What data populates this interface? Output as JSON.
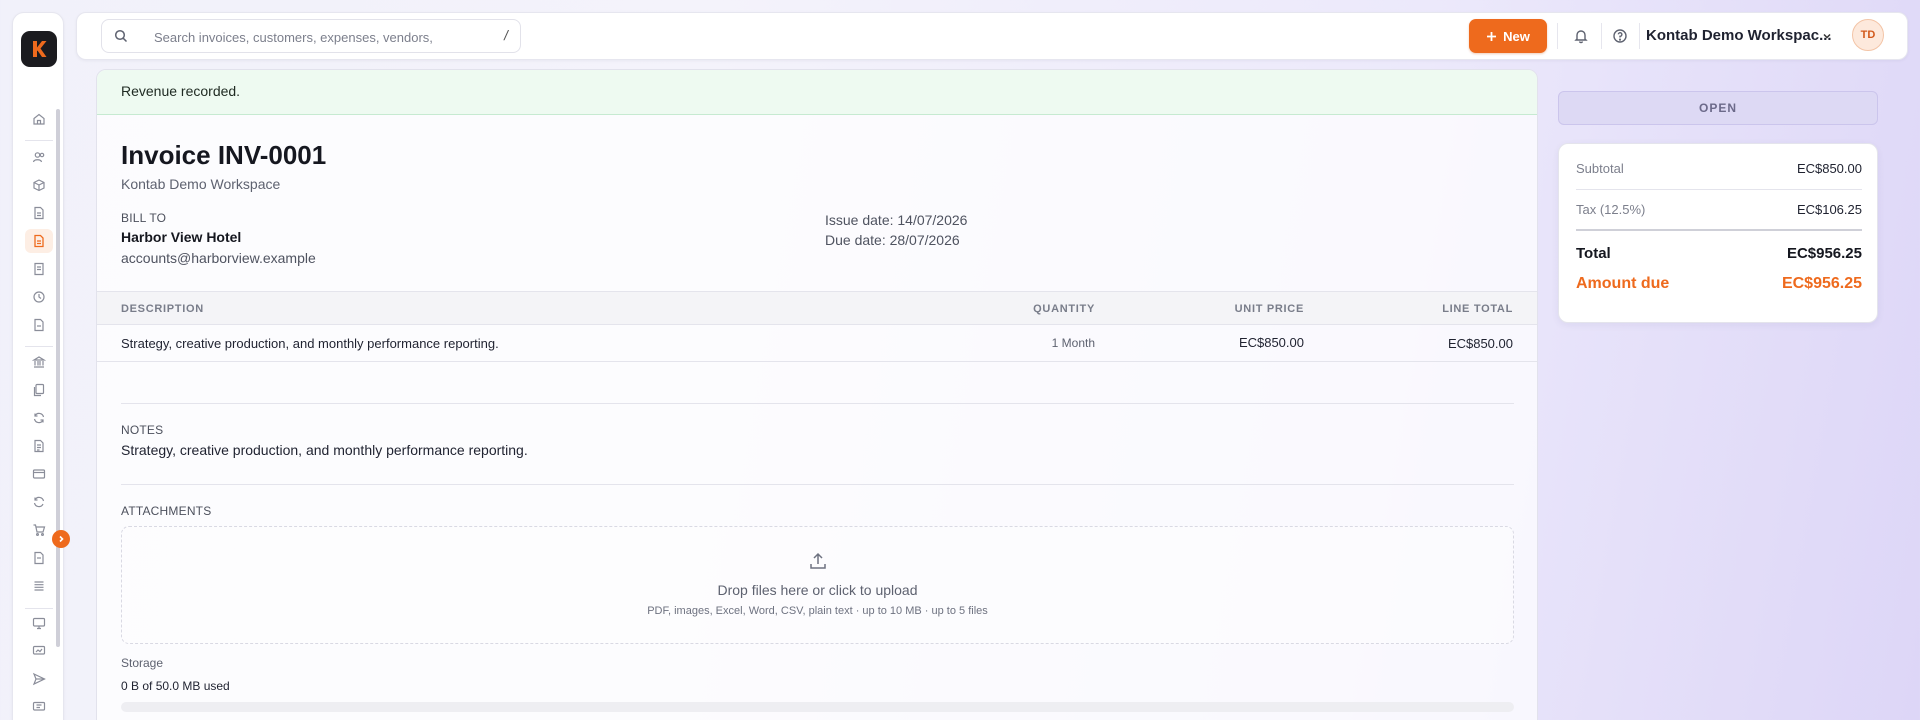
{
  "app": {
    "logo_letter": "K",
    "accent_color": "#ee6a1d"
  },
  "sidebar": {
    "items": [
      {
        "icon": "home-icon",
        "active": false
      },
      {
        "icon": "users-icon",
        "active": false
      },
      {
        "icon": "box-icon",
        "active": false
      },
      {
        "icon": "document-icon",
        "active": false
      },
      {
        "icon": "invoice-icon",
        "active": true
      },
      {
        "icon": "receipt-icon",
        "active": false
      },
      {
        "icon": "clock-icon",
        "active": false
      },
      {
        "icon": "file-icon",
        "active": false
      },
      {
        "icon": "bank-icon",
        "active": false
      },
      {
        "icon": "copy-icon",
        "active": false
      },
      {
        "icon": "refresh-icon",
        "active": false
      },
      {
        "icon": "file-text-icon",
        "active": false
      },
      {
        "icon": "credit-card-icon",
        "active": false
      },
      {
        "icon": "recurring-icon",
        "active": false
      },
      {
        "icon": "cart-icon",
        "active": false
      },
      {
        "icon": "bill-icon",
        "active": false
      },
      {
        "icon": "list-icon",
        "active": false
      },
      {
        "icon": "monitor-icon",
        "active": false
      },
      {
        "icon": "monitor-chart-icon",
        "active": false
      },
      {
        "icon": "send-icon",
        "active": false
      },
      {
        "icon": "report-icon",
        "active": false
      }
    ]
  },
  "topbar": {
    "search_placeholder": "Search invoices, customers, expenses, vendors,",
    "search_shortcut": "/",
    "new_button": "New",
    "workspace_name": "Kontab Demo Workspac...",
    "avatar_initials": "TD"
  },
  "banner": {
    "message": "Revenue recorded.",
    "color": "#eefaf1"
  },
  "invoice": {
    "title": "Invoice INV-0001",
    "workspace": "Kontab Demo Workspace",
    "bill_to_label": "BILL TO",
    "customer_name": "Harbor View Hotel",
    "customer_email": "accounts@harborview.example",
    "issue_date": "Issue date: 14/07/2026",
    "due_date": "Due date: 28/07/2026"
  },
  "line_items": {
    "headers": {
      "description": "DESCRIPTION",
      "quantity": "QUANTITY",
      "unit_price": "UNIT PRICE",
      "line_total": "LINE TOTAL"
    },
    "rows": [
      {
        "description": "Strategy, creative production, and monthly performance reporting.",
        "quantity": "1 Month",
        "unit_price": "EC$850.00",
        "line_total": "EC$850.00"
      }
    ]
  },
  "notes": {
    "label": "NOTES",
    "text": "Strategy, creative production, and monthly performance reporting."
  },
  "attachments": {
    "label": "ATTACHMENTS",
    "drop_title": "Drop files here or click to upload",
    "drop_subtitle": "PDF, images, Excel, Word, CSV, plain text · up to 10 MB · up to 5 files",
    "storage_label": "Storage",
    "storage_used": "0 B of 50.0 MB used",
    "storage_fraction": 0
  },
  "summary": {
    "status": "OPEN",
    "status_color": "#ddd9f4",
    "subtotal_label": "Subtotal",
    "subtotal_value": "EC$850.00",
    "tax_label": "Tax (12.5%)",
    "tax_value": "EC$106.25",
    "total_label": "Total",
    "total_value": "EC$956.25",
    "amount_due_label": "Amount due",
    "amount_due_value": "EC$956.25"
  }
}
